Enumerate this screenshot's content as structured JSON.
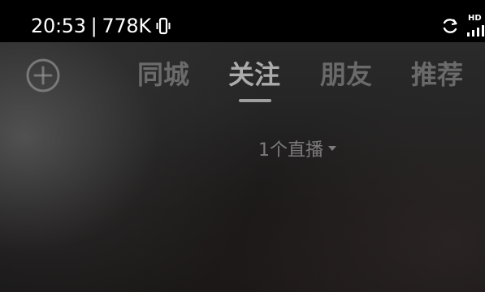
{
  "status_bar": {
    "time": "20:53",
    "separator": "|",
    "network_speed": "778K",
    "hd_label": "HD",
    "icons": [
      "vibrate-icon",
      "sync-icon",
      "signal-icon"
    ]
  },
  "top_nav": {
    "add_icon": "plus-circle-icon",
    "tabs": [
      {
        "label": "同城",
        "active": false
      },
      {
        "label": "关注",
        "active": true
      },
      {
        "label": "朋友",
        "active": false
      },
      {
        "label": "推荐",
        "active": false
      }
    ]
  },
  "live": {
    "label": "1个直播",
    "icon": "caret-down-icon"
  },
  "colors": {
    "status_bar_bg": "#000000",
    "active_tab": "#c8c8c8",
    "inactive_tab": "#969696"
  }
}
